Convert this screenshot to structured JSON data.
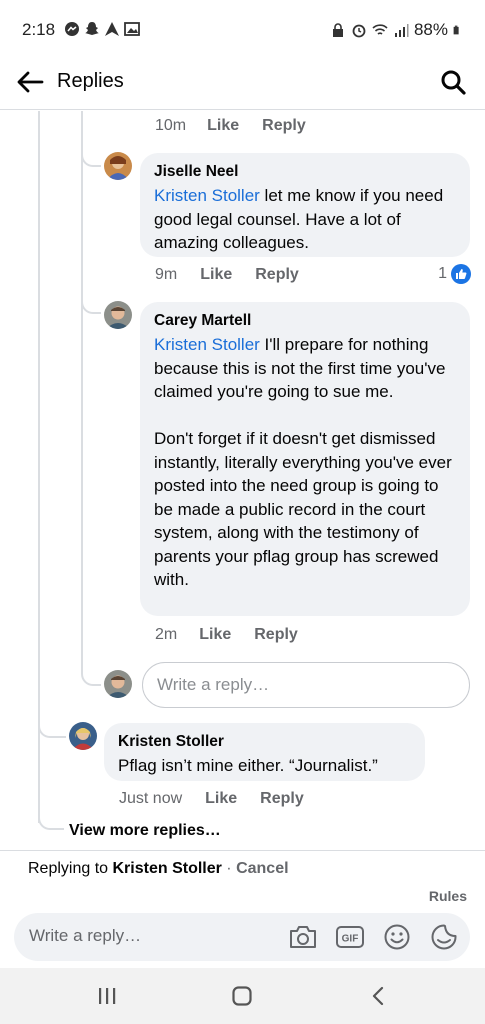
{
  "status_bar": {
    "time": "2:18",
    "battery": "88%"
  },
  "header": {
    "title": "Replies",
    "back_icon": "arrow-left-icon",
    "search_icon": "search-icon"
  },
  "top_comment_meta": {
    "time": "10m",
    "like": "Like",
    "reply": "Reply"
  },
  "comments": [
    {
      "author": "Jiselle Neel",
      "mention": "Kristen Stoller",
      "text": " let me know if you need good legal counsel. Have a lot of amazing colleagues.",
      "time": "9m",
      "like": "Like",
      "reply": "Reply",
      "reaction_count": "1"
    },
    {
      "author": "Carey Martell",
      "mention": "Kristen Stoller",
      "text": " I'll prepare for nothing because this is not the first time you've claimed you're going to sue me.\n\nDon't forget if it doesn't get dismissed instantly, literally everything you've ever posted into the need group is going to be made a public record in the court system, along with the testimony of parents your pflag group has screwed with.",
      "time": "2m",
      "like": "Like",
      "reply": "Reply"
    }
  ],
  "inline_reply": {
    "placeholder": "Write a reply…"
  },
  "kristen_comment": {
    "author": "Kristen Stoller",
    "text": "Pflag isn’t mine either. “Journalist.”",
    "time": "Just now",
    "like": "Like",
    "reply": "Reply"
  },
  "view_more": "View more replies…",
  "replying_bar": {
    "prefix": "Replying to ",
    "name": "Kristen Stoller",
    "separator": " · ",
    "cancel": "Cancel",
    "rules": "Rules",
    "placeholder": "Write a reply…",
    "icons": [
      "camera-icon",
      "gif-icon",
      "emoji-icon",
      "sticker-icon"
    ]
  },
  "colors": {
    "mention": "#1a6ed8",
    "bubble": "#f0f2f5",
    "like_badge": "#1b74e4"
  }
}
